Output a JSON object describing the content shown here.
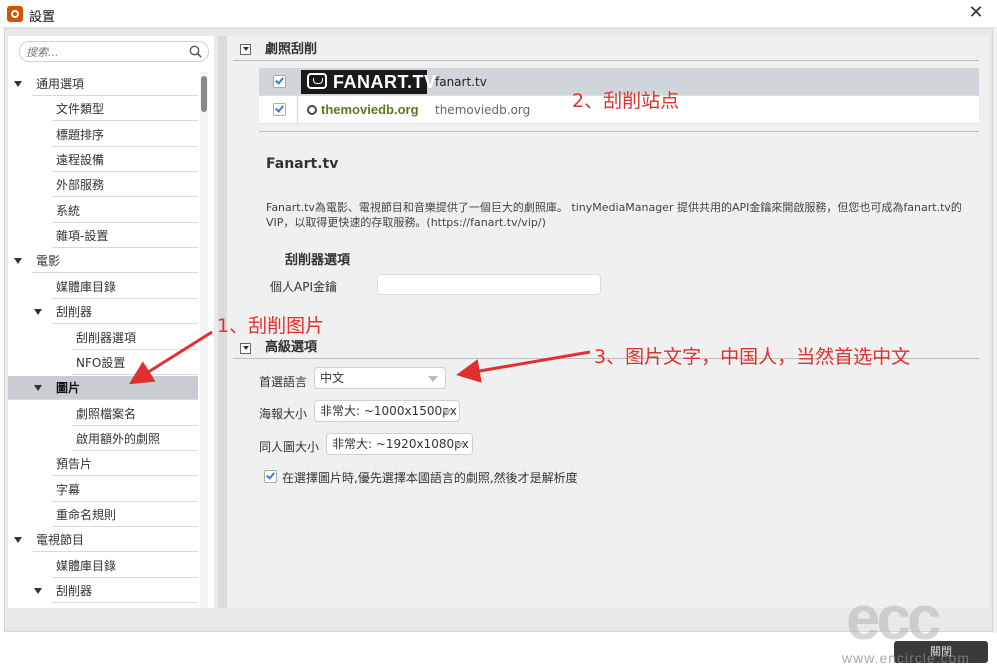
{
  "window": {
    "title": "設置",
    "close_glyph": "✕"
  },
  "sidebar": {
    "search_placeholder": "搜索...",
    "items": [
      {
        "label": "通用選項",
        "level": 0,
        "expanded": true
      },
      {
        "label": "文件類型",
        "level": 1
      },
      {
        "label": "標題排序",
        "level": 1
      },
      {
        "label": "遠程設備",
        "level": 1
      },
      {
        "label": "外部服務",
        "level": 1
      },
      {
        "label": "系統",
        "level": 1
      },
      {
        "label": "雜項-設置",
        "level": 1
      },
      {
        "label": "電影",
        "level": 0,
        "expanded": true
      },
      {
        "label": "媒體庫目錄",
        "level": 1
      },
      {
        "label": "刮削器",
        "level": 1,
        "expanded": true
      },
      {
        "label": "刮削器選項",
        "level": 2
      },
      {
        "label": "NFO設置",
        "level": 2
      },
      {
        "label": "圖片",
        "level": 1,
        "expanded": true,
        "selected": true
      },
      {
        "label": "劇照檔案名",
        "level": 2
      },
      {
        "label": "啟用額外的劇照",
        "level": 2
      },
      {
        "label": "預告片",
        "level": 1
      },
      {
        "label": "字幕",
        "level": 1
      },
      {
        "label": "重命名規則",
        "level": 1
      },
      {
        "label": "電視節目",
        "level": 0,
        "expanded": true
      },
      {
        "label": "媒體庫目錄",
        "level": 1
      },
      {
        "label": "刮削器",
        "level": 1,
        "expanded": true
      }
    ]
  },
  "artwork_section": {
    "title": "劇照刮削",
    "scrapers": [
      {
        "logo_text": "FANART.TV",
        "name": "fanart.tv",
        "checked": true,
        "selected": true
      },
      {
        "logo_text": "themoviedb.org",
        "name": "themoviedb.org",
        "checked": true,
        "selected": false
      }
    ]
  },
  "details": {
    "title": "Fanart.tv",
    "description": "Fanart.tv為電影、電視節目和音樂提供了一個巨大的劇照庫。 tinyMediaManager 提供共用的API金鑰來開啟服務，但您也可成為fanart.tv的VIP，以取得更快速的存取服務。(https://fanart.tv/vip/)",
    "options_title": "刮削器選項",
    "api_key_label": "個人API金鑰",
    "api_key_value": ""
  },
  "advanced": {
    "title": "高級選項",
    "preferred_language_label": "首選語言",
    "preferred_language_value": "中文",
    "poster_size_label": "海報大小",
    "poster_size_value": "非常大: ~1000x1500px",
    "fanart_size_label": "同人圖大小",
    "fanart_size_value": "非常大: ~1920x1080px",
    "prefer_language_checkbox_label": "在選擇圖片時,優先選擇本國語言的劇照,然後才是解析度",
    "prefer_language_checked": true
  },
  "annotations": {
    "a1": "1、刮削图片",
    "a2": "2、刮削站点",
    "a3": "3、图片文字，中国人，当然首选中文"
  },
  "footer": {
    "close_label": "關閉"
  },
  "watermark": {
    "logo": "ecc",
    "url": "www.encircle.com"
  },
  "colors": {
    "annotation_red": "#e03030",
    "selection_gray": "#c9cdd3",
    "checkbox_blue": "#3d7cc9"
  }
}
